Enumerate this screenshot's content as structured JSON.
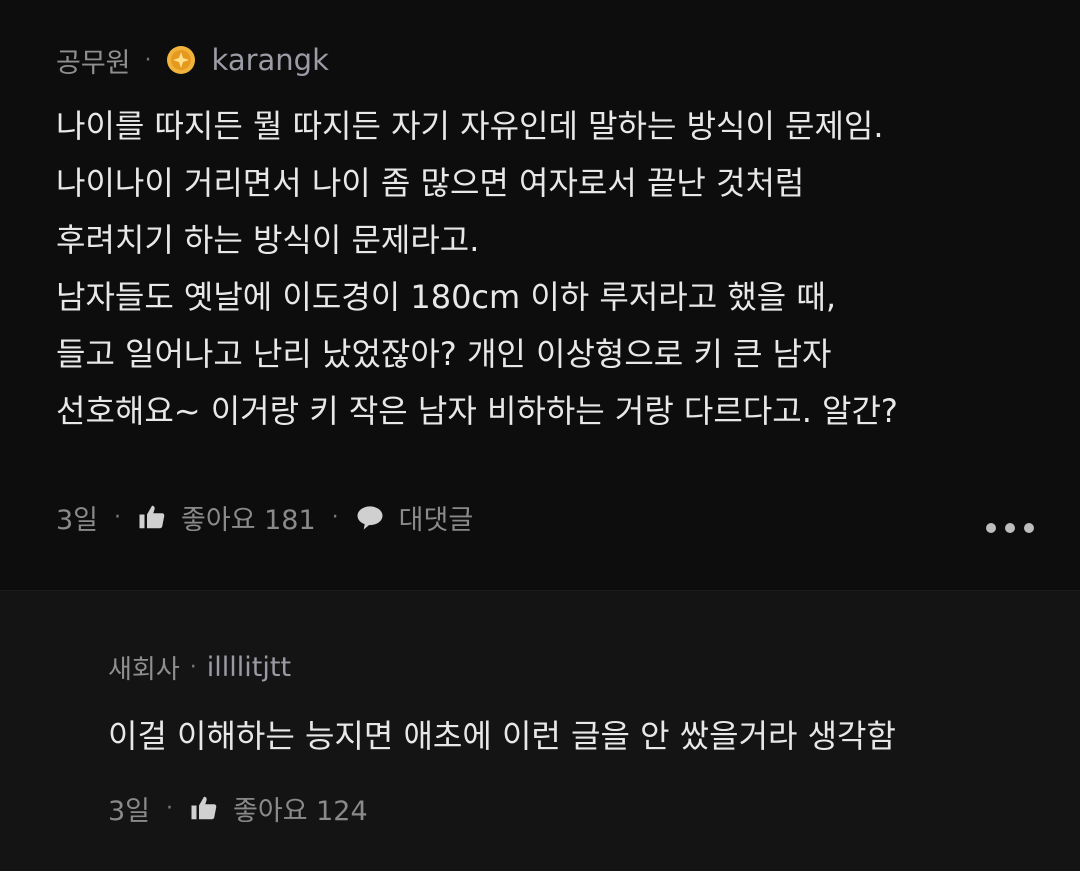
{
  "comment": {
    "company": "공무원",
    "separator": "·",
    "username": "karangk",
    "lines": [
      "나이를 따지든 뭘 따지든 자기 자유인데 말하는 방식이 문제임.",
      "나이나이 거리면서 나이 좀 많으면 여자로서 끝난 것처럼",
      "후려치기 하는 방식이 문제라고.",
      "남자들도 옛날에 이도경이 180cm 이하 루저라고 했을 때,",
      "들고 일어나고 난리 났었잖아? 개인 이상형으로 키 큰 남자",
      "선호해요~ 이거랑 키 작은 남자 비하하는 거랑 다르다고. 알간?"
    ],
    "time": "3일",
    "like_label": "좋아요 181",
    "reply_label": "대댓글",
    "badge_color": "#f2b33d"
  },
  "reply": {
    "company": "새회사",
    "separator": "·",
    "username": "illllitjtt",
    "text": "이걸 이해하는 능지면 애초에 이런 글을 안 쌌을거라 생각함",
    "time": "3일",
    "like_label": "좋아요 124"
  },
  "icons": {
    "badge": "gold-coin-badge-icon",
    "like": "thumbs-up-icon",
    "reply": "speech-bubble-icon",
    "more": "more-dots-icon"
  }
}
